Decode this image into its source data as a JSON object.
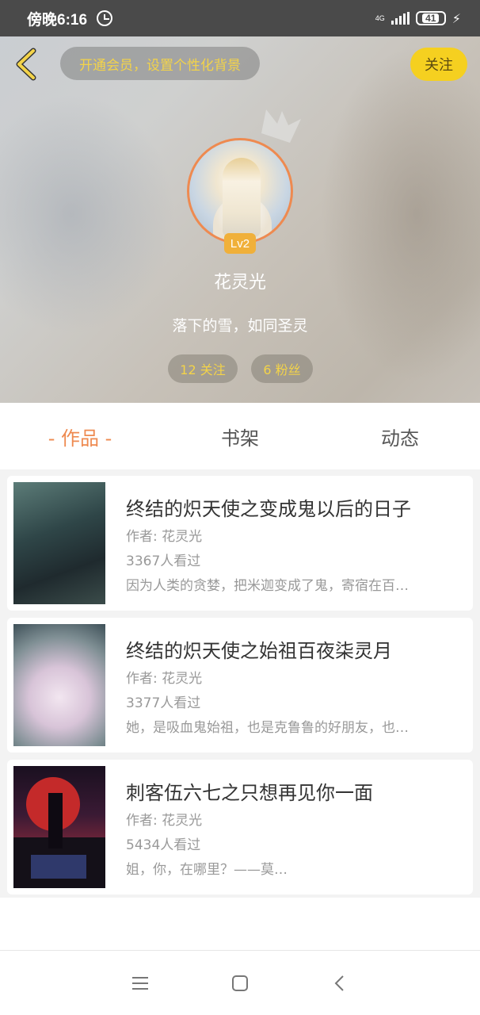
{
  "status_bar": {
    "time": "傍晚6:16",
    "network": "4G",
    "battery": "41"
  },
  "header": {
    "vip_text": "开通会员，设置个性化背景",
    "follow_label": "关注"
  },
  "profile": {
    "level": "Lv2",
    "name": "花灵光",
    "signature": "落下的雪，如同圣灵",
    "following": "12 关注",
    "fans": "6 粉丝"
  },
  "tabs": [
    {
      "label": "- 作品 -",
      "active": true
    },
    {
      "label": "书架",
      "active": false
    },
    {
      "label": "动态",
      "active": false
    }
  ],
  "books": [
    {
      "title": "终结的炽天使之变成鬼以后的日子",
      "author": "作者: 花灵光",
      "views": "3367人看过",
      "desc": "因为人类的贪婪，把米迦变成了鬼，寄宿在百…"
    },
    {
      "title": "终结的炽天使之始祖百夜柒灵月",
      "author": "作者: 花灵光",
      "views": "3377人看过",
      "desc": "她，是吸血鬼始祖，也是克鲁鲁的好朋友，也…"
    },
    {
      "title": "刺客伍六七之只想再见你一面",
      "author": "作者: 花灵光",
      "views": "5434人看过",
      "desc": "姐，你，在哪里？——莫…"
    }
  ],
  "colors": {
    "accent_orange": "#ee8a50",
    "accent_yellow": "#f5d020",
    "level_badge": "#f0b03a"
  }
}
